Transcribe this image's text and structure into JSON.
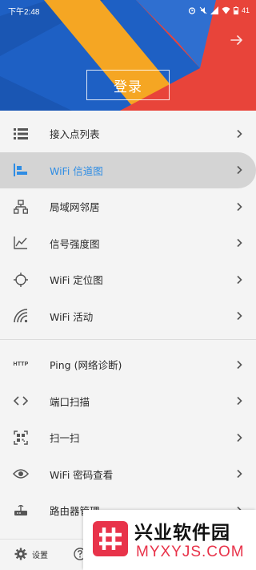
{
  "status_bar": {
    "time": "下午2:48",
    "battery": "41"
  },
  "header": {
    "login_label": "登录"
  },
  "menu": {
    "items": [
      {
        "label": "接入点列表",
        "icon": "list-icon"
      },
      {
        "label": "WiFi 信道图",
        "icon": "channel-chart-icon"
      },
      {
        "label": "局域网邻居",
        "icon": "lan-tree-icon"
      },
      {
        "label": "信号强度图",
        "icon": "line-chart-icon"
      },
      {
        "label": "WiFi 定位图",
        "icon": "crosshair-icon"
      },
      {
        "label": "WiFi 活动",
        "icon": "wifi-signal-icon"
      },
      {
        "label": "Ping (网络诊断)",
        "icon": "http-icon",
        "icon_text": "HTTP"
      },
      {
        "label": "端口扫描",
        "icon": "code-brackets-icon"
      },
      {
        "label": "扫一扫",
        "icon": "qr-scan-icon"
      },
      {
        "label": "WiFi 密码查看",
        "icon": "eye-icon"
      },
      {
        "label": "路由器管理",
        "icon": "router-icon"
      }
    ],
    "active_index": 1
  },
  "bottom": {
    "settings_label": "设置"
  },
  "watermark": {
    "title": "兴业软件园",
    "url": "MYXYJS.COM"
  },
  "colors": {
    "accent": "#2f8de4",
    "header_blue": "#1d5fc0",
    "header_orange": "#f5a623",
    "header_red": "#e8443a",
    "watermark_red": "#e8334a"
  }
}
